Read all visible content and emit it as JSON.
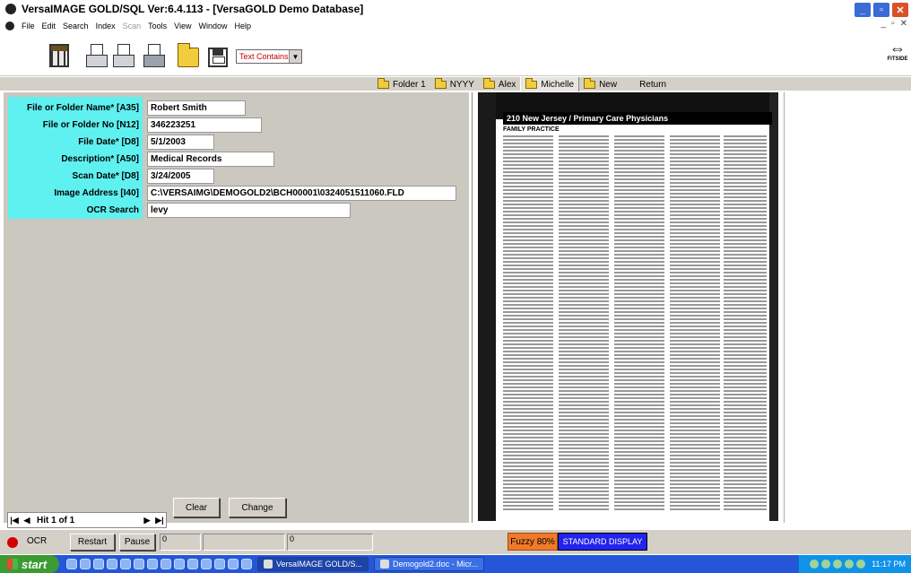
{
  "window": {
    "title": "VersaIMAGE GOLD/SQL Ver:6.4.113 - [VersaGOLD Demo Database]"
  },
  "menu": {
    "items": [
      "File",
      "Edit",
      "Search",
      "Index",
      "Scan",
      "Tools",
      "View",
      "Window",
      "Help"
    ],
    "disabled": [
      "Scan"
    ]
  },
  "toolbar": {
    "search_mode": "Text Contains",
    "fitside_label": "FITSIDE"
  },
  "folder_tabs": {
    "tabs": [
      "Folder 1",
      "NYYY",
      "Alex",
      "Michelle",
      "New"
    ],
    "active": "Michelle",
    "return_label": "Return"
  },
  "form": {
    "fields": [
      {
        "label": "File or Folder Name* [A35]",
        "value": "Robert Smith"
      },
      {
        "label": "File or Folder No [N12]",
        "value": "346223251"
      },
      {
        "label": "File Date* [D8]",
        "value": "5/1/2003"
      },
      {
        "label": "Description* [A50]",
        "value": "Medical Records"
      },
      {
        "label": "Scan Date* [D8]",
        "value": "3/24/2005"
      },
      {
        "label": "Image Address [I40]",
        "value": "C:\\VERSAIMG\\DEMOGOLD2\\BCH00001\\0324051511060.FLD"
      },
      {
        "label": "OCR Search",
        "value": "levy"
      }
    ],
    "nav_text": "Hit 1 of 1",
    "clear_label": "Clear",
    "change_label": "Change"
  },
  "document": {
    "page_header": "210 New Jersey / Primary Care Physicians",
    "section_title": "FAMILY PRACTICE"
  },
  "status": {
    "ocr_label": "OCR",
    "restart_label": "Restart",
    "pause_label": "Pause",
    "box1": "0",
    "box3": "0",
    "fuzzy_label": "Fuzzy 80%",
    "display_label": "STANDARD DISPLAY"
  },
  "taskbar": {
    "start_label": "start",
    "tasks": [
      "VersaIMAGE GOLD/S...",
      "Demogold2.doc - Micr..."
    ],
    "clock": "11:17 PM"
  },
  "colors": {
    "label_bg": "#5ff0f0",
    "fuzzy_bg": "#f07a2a",
    "display_bg": "#2323ee",
    "ocr_dot": "#d40000"
  }
}
